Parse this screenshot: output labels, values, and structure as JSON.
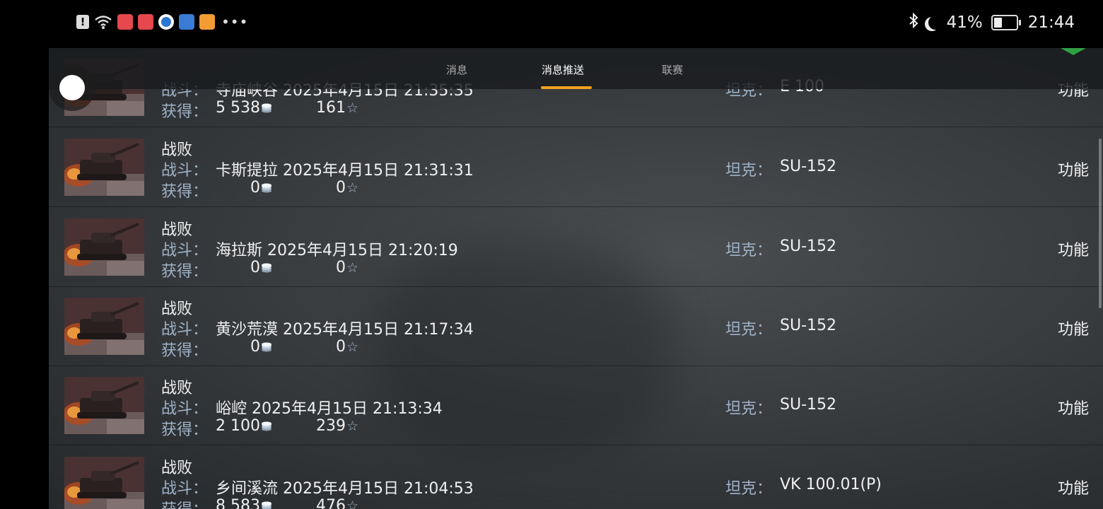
{
  "status_bar": {
    "battery": "41%",
    "time": "21:44",
    "battery_fraction": 0.41
  },
  "tabs": [
    {
      "label": "消息",
      "active": false
    },
    {
      "label": "消息推送",
      "active": true
    },
    {
      "label": "联赛",
      "active": false
    }
  ],
  "labels": {
    "battle": "战斗：",
    "earned": "获得：",
    "tank": "坦克：",
    "function": "功能"
  },
  "rows": [
    {
      "result": "",
      "battle": "寺庙峡谷 2025年4月15日 21:35:35",
      "credits": "5 538",
      "xp": "161",
      "tank": "E 100"
    },
    {
      "result": "战败",
      "battle": "卡斯提拉 2025年4月15日 21:31:31",
      "credits": "0",
      "xp": "0",
      "tank": "SU-152"
    },
    {
      "result": "战败",
      "battle": "海拉斯 2025年4月15日 21:20:19",
      "credits": "0",
      "xp": "0",
      "tank": "SU-152"
    },
    {
      "result": "战败",
      "battle": "黄沙荒漠 2025年4月15日 21:17:34",
      "credits": "0",
      "xp": "0",
      "tank": "SU-152"
    },
    {
      "result": "战败",
      "battle": "峪崆 2025年4月15日 21:13:34",
      "credits": "2 100",
      "xp": "239",
      "tank": "SU-152"
    },
    {
      "result": "战败",
      "battle": "乡间溪流 2025年4月15日 21:04:53",
      "credits": "8 583",
      "xp": "476",
      "tank": "VK 100.01(P)"
    }
  ],
  "colors": {
    "tab_accent": "#f0a020",
    "label_color": "#9fb3c8"
  }
}
